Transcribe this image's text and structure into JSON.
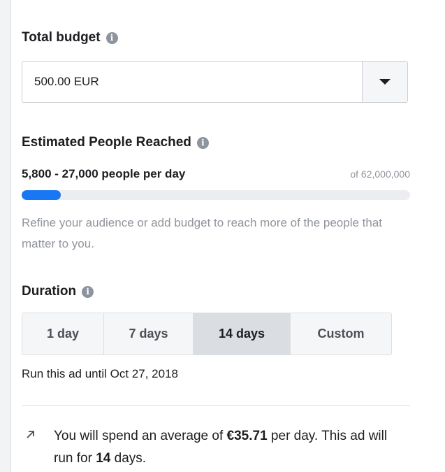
{
  "budget": {
    "title": "Total budget",
    "value": "500.00 EUR"
  },
  "reach": {
    "title": "Estimated People Reached",
    "range": "5,800 - 27,000 people per day",
    "of_total": "of 62,000,000",
    "progress_fraction": 0.1,
    "hint": "Refine your audience or add budget to reach more of the people that matter to you."
  },
  "duration": {
    "title": "Duration",
    "options": [
      "1 day",
      "7 days",
      "14 days",
      "Custom"
    ],
    "selected": "14 days",
    "run_until_prefix": "Run this ad until",
    "run_until_date": "Oct 27, 2018"
  },
  "summary": {
    "part1": "You will spend an average of ",
    "amount": "€35.71",
    "part2": " per day. This ad will run for ",
    "days": "14",
    "part3": " days."
  },
  "icons": {
    "info": "info-icon",
    "caret": "caret-down-icon",
    "arrow": "arrow-up-right-icon"
  },
  "colors": {
    "accent": "#1877f2",
    "muted_text": "#90949c",
    "selected_bg": "#dadde1"
  }
}
